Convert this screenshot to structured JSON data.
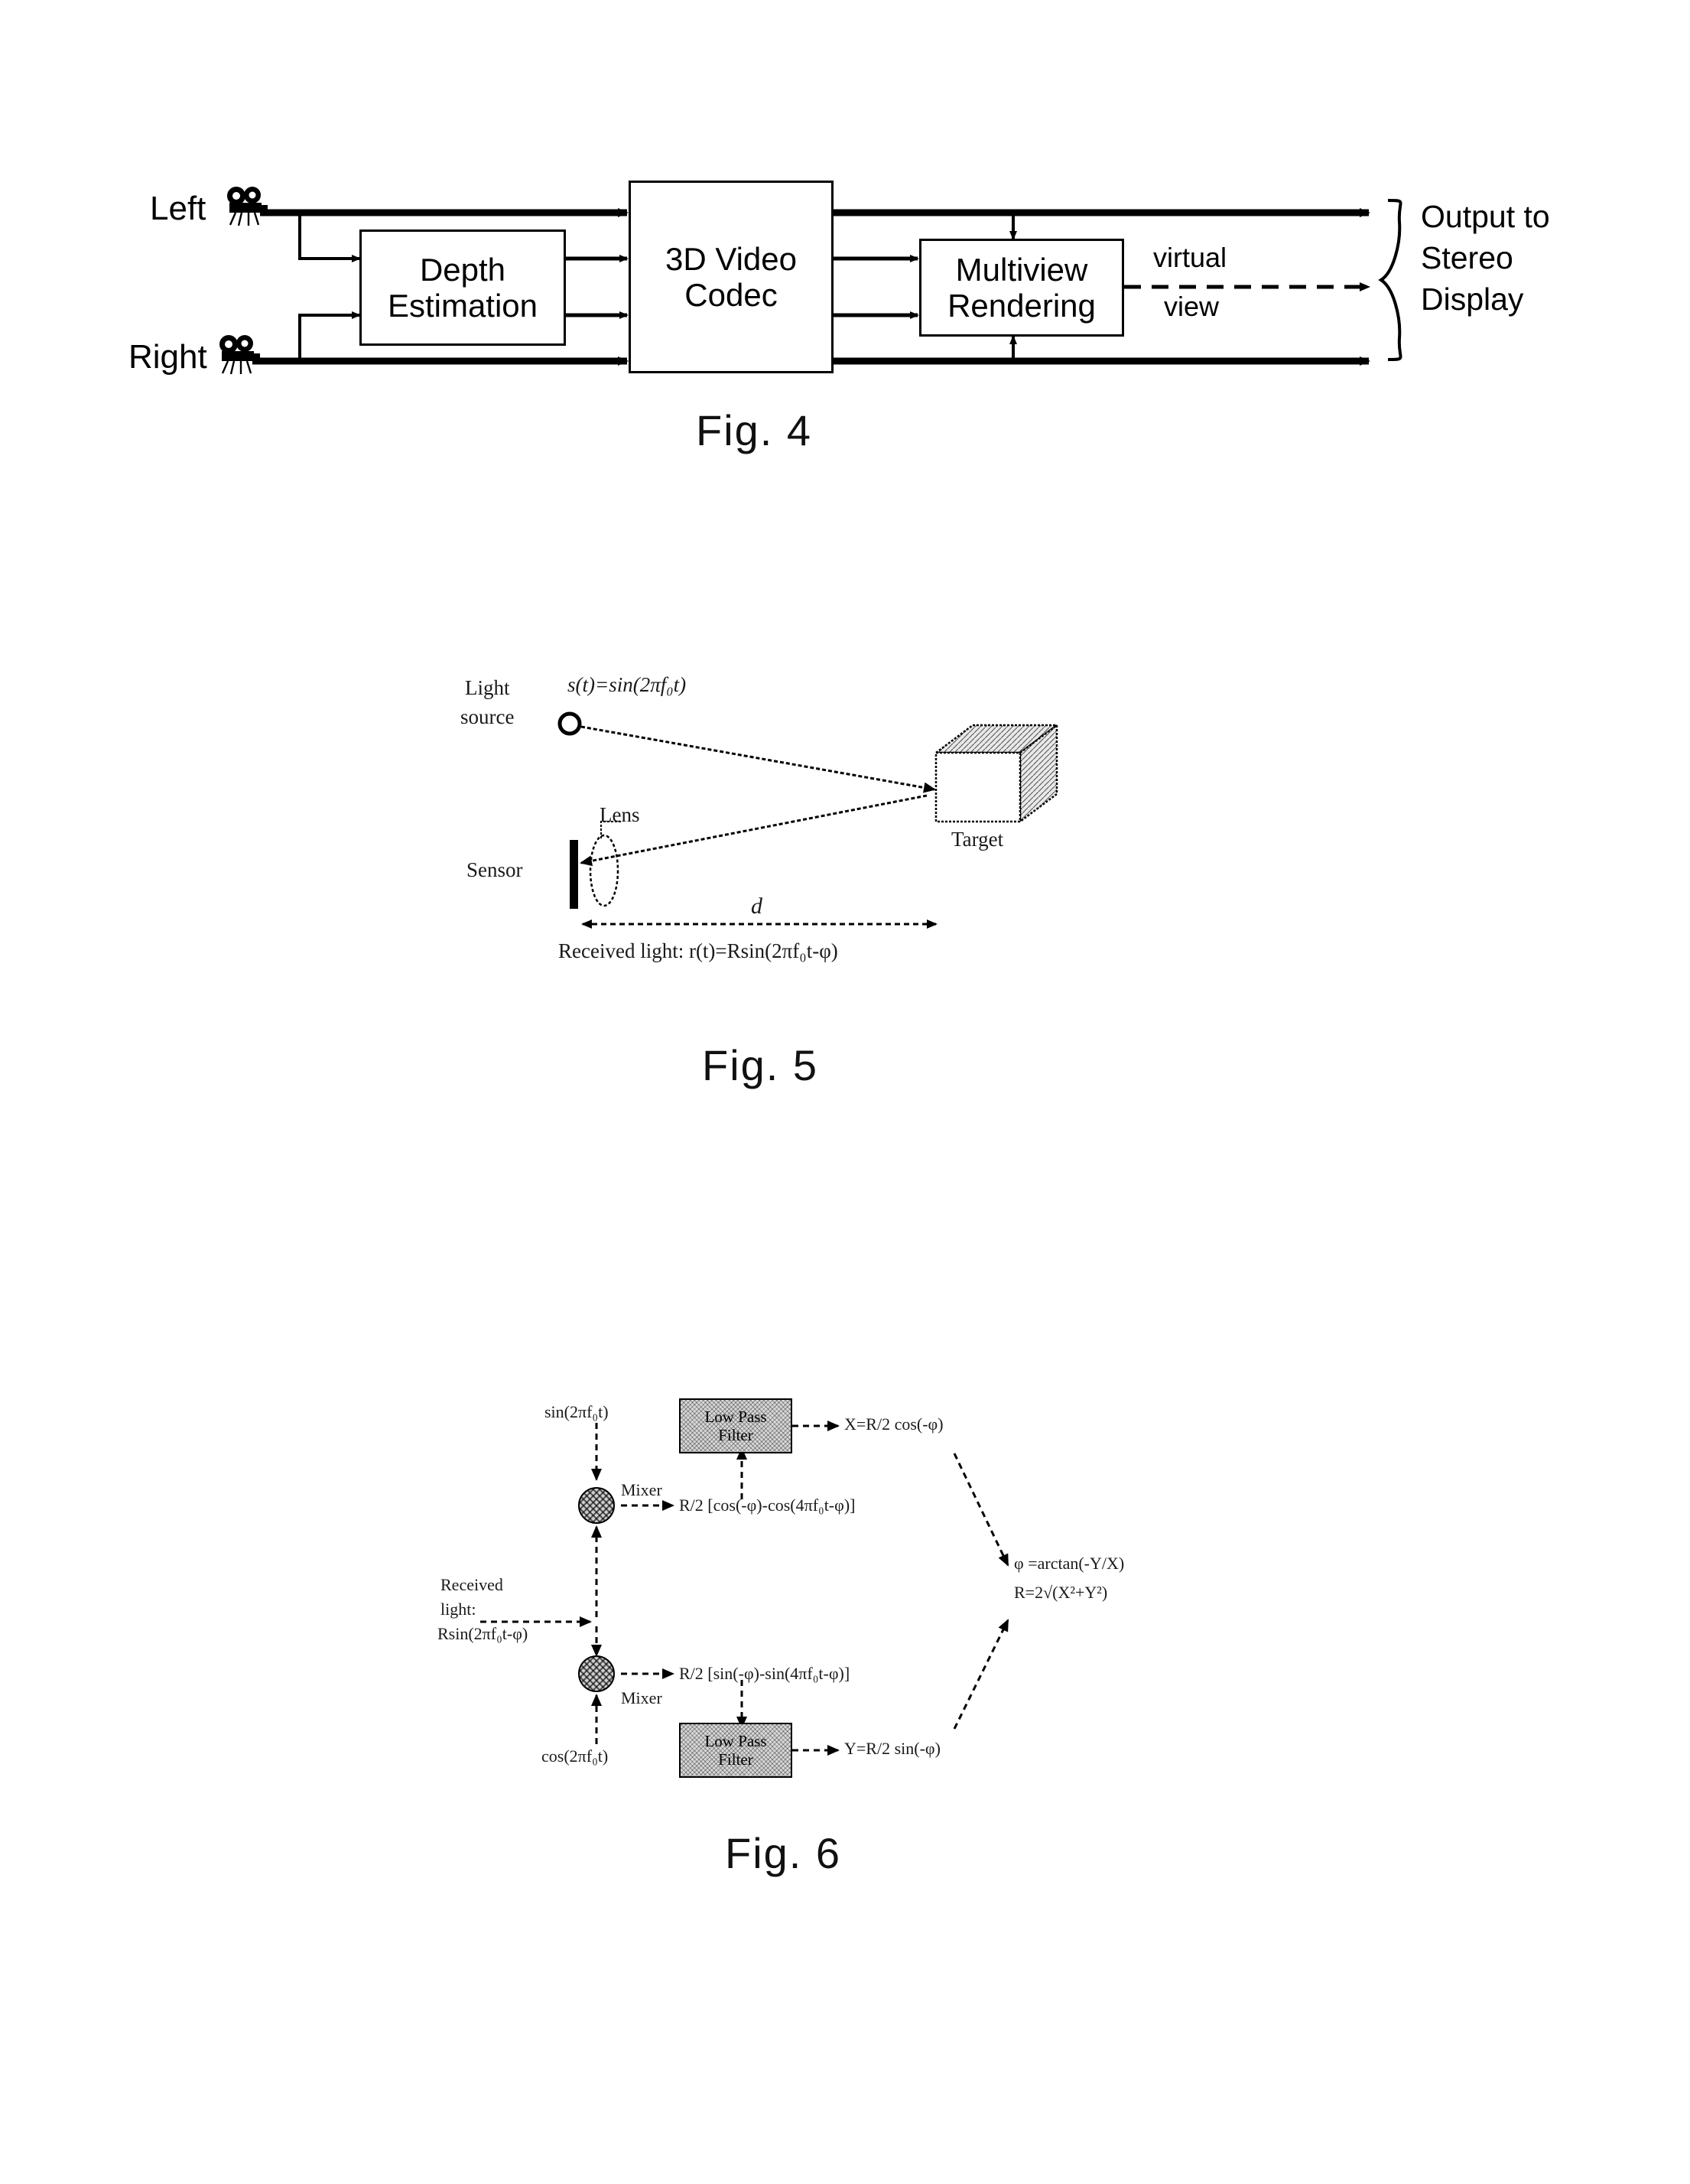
{
  "document": {
    "type": "patent-figure-sheet",
    "background": "#ffffff",
    "figure_count": 3
  },
  "fig4": {
    "caption": "Fig. 4",
    "inputs": [
      {
        "label": "Left",
        "icon": "movie-camera-icon"
      },
      {
        "label": "Right",
        "icon": "movie-camera-icon"
      }
    ],
    "blocks": [
      {
        "id": "depth-estimation",
        "line1": "Depth",
        "line2": "Estimation"
      },
      {
        "id": "video-codec",
        "line1": "3D Video",
        "line2": "Codec"
      },
      {
        "id": "multiview-rendering",
        "line1": "Multiview",
        "line2": "Rendering"
      }
    ],
    "annotations": {
      "virtual_view_line1": "virtual",
      "virtual_view_line2": "view",
      "output_line1": "Output to",
      "output_line2": "Stereo",
      "output_line3": "Display"
    }
  },
  "fig5": {
    "caption": "Fig. 5",
    "labels": {
      "light_source_line1": "Light",
      "light_source_line2": "source",
      "emitted_signal": "s(t)=sin(2πf₀t)",
      "lens": "Lens",
      "sensor": "Sensor",
      "target": "Target",
      "distance": "d",
      "received": "Received light: r(t)=Rsin(2πf₀t-φ)"
    }
  },
  "fig6": {
    "caption": "Fig. 6",
    "labels": {
      "ref_sin": "sin(2πf₀t)",
      "ref_cos": "cos(2πf₀t)",
      "received_line1": "Received",
      "received_line2": "light:",
      "received_line3": "Rsin(2πf₀t-φ)",
      "mixer_top": "Mixer",
      "mixer_bottom": "Mixer",
      "lpf_top_line1": "Low Pass",
      "lpf_top_line2": "Filter",
      "lpf_bottom_line1": "Low Pass",
      "lpf_bottom_line2": "Filter",
      "mix_out_top": "R/2 [cos(-φ)-cos(4πf₀t-φ)]",
      "mix_out_bottom": "R/2 [sin(-φ)-sin(4πf₀t-φ)]",
      "x_out": "X=R/2 cos(-φ)",
      "y_out": "Y=R/2 sin(-φ)",
      "result_line1": "φ =arctan(-Y/X)",
      "result_line2": "R=2√(X²+Y²)"
    }
  }
}
